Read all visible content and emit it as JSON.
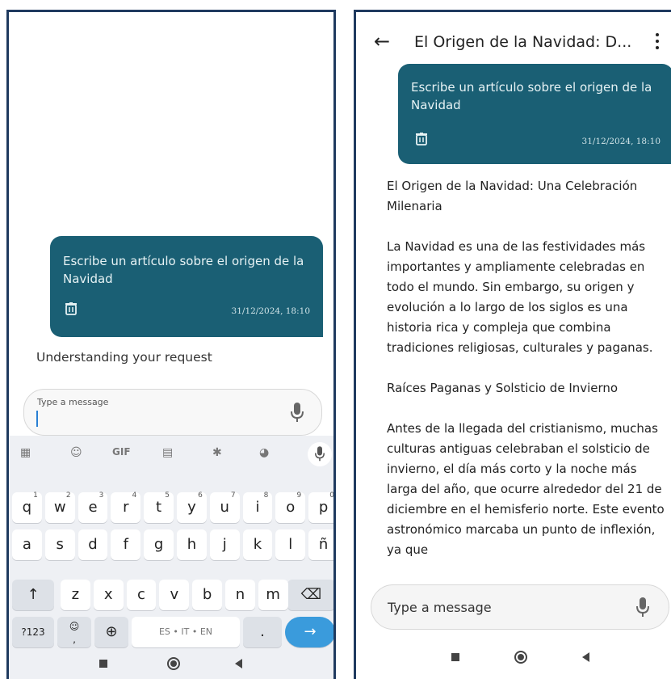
{
  "left": {
    "bubble": {
      "message": "Escribe un artículo sobre el origen de la Navidad",
      "timestamp": "31/12/2024, 18:10"
    },
    "status": "Understanding your request",
    "input": {
      "placeholder": "Type a message"
    },
    "keyboard": {
      "toolbar": {
        "gif": "GIF"
      },
      "rows": [
        [
          {
            "k": "q",
            "h": "1"
          },
          {
            "k": "w",
            "h": "2"
          },
          {
            "k": "e",
            "h": "3"
          },
          {
            "k": "r",
            "h": "4"
          },
          {
            "k": "t",
            "h": "5"
          },
          {
            "k": "y",
            "h": "6"
          },
          {
            "k": "u",
            "h": "7"
          },
          {
            "k": "i",
            "h": "8"
          },
          {
            "k": "o",
            "h": "9"
          },
          {
            "k": "p",
            "h": "0"
          }
        ],
        [
          {
            "k": "a"
          },
          {
            "k": "s"
          },
          {
            "k": "d"
          },
          {
            "k": "f"
          },
          {
            "k": "g"
          },
          {
            "k": "h"
          },
          {
            "k": "j"
          },
          {
            "k": "k"
          },
          {
            "k": "l"
          },
          {
            "k": "ñ"
          }
        ],
        [
          {
            "k": "z"
          },
          {
            "k": "x"
          },
          {
            "k": "c"
          },
          {
            "k": "v"
          },
          {
            "k": "b"
          },
          {
            "k": "n"
          },
          {
            "k": "m"
          }
        ]
      ],
      "shift": "↑",
      "backspace": "⌫",
      "symbols": "?123",
      "emoji_comma": ",",
      "emoji": "☺",
      "globe": "⊕",
      "space": "ES • IT • EN",
      "period": ".",
      "enter": "→"
    }
  },
  "right": {
    "title": "El Origen de la Navidad: D...",
    "back": "←",
    "bubble": {
      "message": "Escribe un artículo sobre el origen de la Navidad",
      "timestamp": "31/12/2024, 18:10"
    },
    "article": {
      "heading": "El Origen de la Navidad: Una Celebración Milenaria",
      "p1": "La Navidad es una de las festividades más importantes y ampliamente celebradas en todo el mundo. Sin embargo, su origen y evolución a lo largo de los siglos es una historia rica y compleja que combina tradiciones religiosas, culturales y paganas.",
      "subheading": "Raíces Paganas y Solsticio de Invierno",
      "p2": "Antes de la llegada del cristianismo, muchas culturas antiguas celebraban el solsticio de invierno, el día más corto y la noche más larga del año, que ocurre alrededor del 21 de diciembre en el hemisferio norte. Este evento astronómico marcaba un punto de inflexión, ya que"
    },
    "input": {
      "placeholder": "Type a message"
    }
  },
  "icons": {
    "trash": "trash-icon",
    "mic": "mic-icon",
    "back": "back-arrow-icon",
    "more": "more-vert-icon",
    "grid": "apps-grid-icon",
    "sticker": "sticker-icon",
    "clipboard": "clipboard-icon",
    "settings": "gear-icon",
    "palette": "palette-icon",
    "nav_recent": "recents-square-icon",
    "nav_home": "home-circle-icon",
    "nav_back": "back-triangle-icon"
  },
  "colors": {
    "bubble": "#1a5f74",
    "accent": "#3a9bdc",
    "frame": "#1f3a5f"
  }
}
